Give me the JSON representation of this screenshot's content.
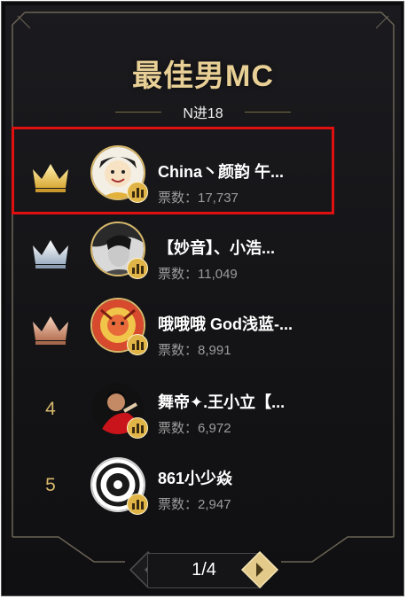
{
  "panel": {
    "title": "最佳男MC",
    "subtitle": "N进18"
  },
  "ranking": [
    {
      "rank": "1",
      "name": "China丶颜韵 午...",
      "votes": "票数：17,737",
      "crown": "gold-crown-icon"
    },
    {
      "rank": "2",
      "name": "【妙音】、小浩...",
      "votes": "票数：11,049",
      "crown": "silver-crown-icon"
    },
    {
      "rank": "3",
      "name": "哦哦哦 God浅蓝-...",
      "votes": "票数：8,991",
      "crown": "bronze-crown-icon"
    },
    {
      "rank": "4",
      "name": "舞帝✦.王小立【...",
      "votes": "票数：6,972"
    },
    {
      "rank": "5",
      "name": "861小少焱",
      "votes": "票数：2,947"
    }
  ],
  "pagination": {
    "label": "1/4",
    "prev_icon": "chevron-left-icon",
    "next_icon": "chevron-right-icon"
  },
  "colors": {
    "gold": "#e8cf95",
    "highlight_border": "#e01010",
    "badge": "#e0b447"
  }
}
